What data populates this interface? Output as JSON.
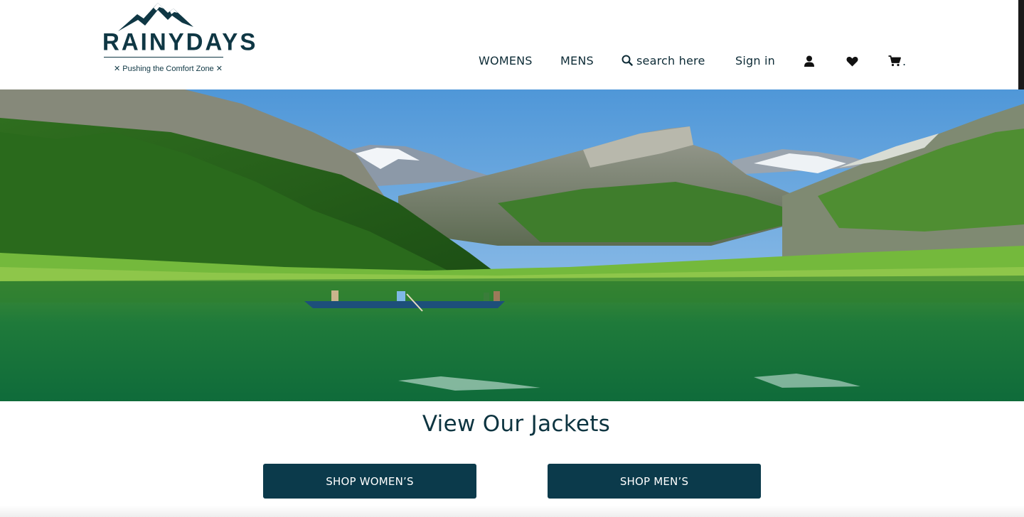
{
  "brand": {
    "name": "RAINYDAYS",
    "tagline": "✕ Pushing the Comfort Zone ✕"
  },
  "nav": {
    "womens": "WOMENS",
    "mens": "MENS",
    "search_placeholder": "search here",
    "sign_in": "Sign in",
    "cart_suffix": "."
  },
  "icons": {
    "search": "search-icon",
    "account": "user-icon",
    "wishlist": "heart-icon",
    "cart": "cart-icon"
  },
  "main": {
    "section_title": "View Our Jackets",
    "shop_womens_label": "SHOP WOMEN’S",
    "shop_mens_label": "SHOP MEN’S"
  },
  "colors": {
    "brand_dark": "#0b3a4b",
    "text": "#0d2b36"
  }
}
